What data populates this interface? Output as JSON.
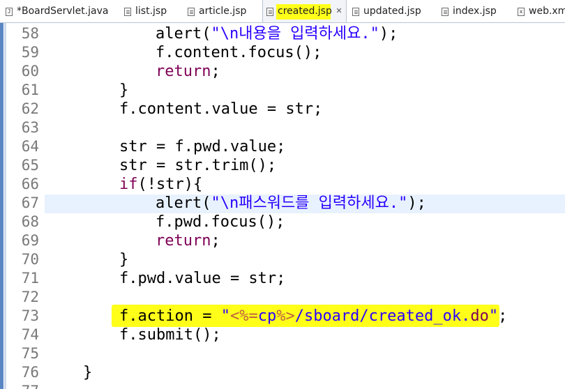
{
  "tabs": [
    {
      "label": "*BoardServlet.java",
      "icon": "java-file-icon"
    },
    {
      "label": "list.jsp",
      "icon": "jsp-file-icon"
    },
    {
      "label": "article.jsp",
      "icon": "jsp-file-icon"
    },
    {
      "label": "created.jsp",
      "icon": "jsp-file-icon",
      "active": true
    },
    {
      "label": "updated.jsp",
      "icon": "jsp-file-icon"
    },
    {
      "label": "index.jsp",
      "icon": "jsp-file-icon"
    },
    {
      "label": "web.xm",
      "icon": "xml-file-icon"
    }
  ],
  "tab_close_glyph": "✕",
  "java_icon_letter": "J",
  "xml_icon_letter": "x",
  "colors": {
    "keyword": "#7f0055",
    "string": "#2a00ff",
    "jsp_tag": "#bf5f3f",
    "highlight": "#ffff1a",
    "current_line": "#e8f2fe",
    "line_number": "#787878"
  },
  "lines": [
    {
      "n": "58",
      "parts": [
        {
          "t": "alert(",
          "c": ""
        },
        {
          "t": "\"\\n내용을 입력하세요.\"",
          "c": "str"
        },
        {
          "t": ");",
          "c": ""
        }
      ]
    },
    {
      "n": "59",
      "parts": [
        {
          "t": "f.content.focus();",
          "c": ""
        }
      ]
    },
    {
      "n": "60",
      "parts": [
        {
          "t": "return",
          "c": "kw"
        },
        {
          "t": ";",
          "c": ""
        }
      ]
    },
    {
      "n": "61",
      "parts": [
        {
          "t": "}",
          "c": ""
        }
      ]
    },
    {
      "n": "62",
      "parts": [
        {
          "t": "f.content.value = str;",
          "c": ""
        }
      ]
    },
    {
      "n": "63",
      "parts": []
    },
    {
      "n": "64",
      "parts": [
        {
          "t": "str = f.pwd.value;",
          "c": ""
        }
      ]
    },
    {
      "n": "65",
      "parts": [
        {
          "t": "str = str.trim();",
          "c": ""
        }
      ]
    },
    {
      "n": "66",
      "parts": [
        {
          "t": "if",
          "c": "kw"
        },
        {
          "t": "(!str){",
          "c": ""
        }
      ]
    },
    {
      "n": "67",
      "parts": [
        {
          "t": "alert(",
          "c": ""
        },
        {
          "t": "\"\\n패스워드를 입력하세요.\"",
          "c": "str"
        },
        {
          "t": ");",
          "c": ""
        }
      ]
    },
    {
      "n": "68",
      "parts": [
        {
          "t": "f.pwd.focus();",
          "c": ""
        }
      ]
    },
    {
      "n": "69",
      "parts": [
        {
          "t": "return",
          "c": "kw"
        },
        {
          "t": ";",
          "c": ""
        }
      ]
    },
    {
      "n": "70",
      "parts": [
        {
          "t": "}",
          "c": ""
        }
      ]
    },
    {
      "n": "71",
      "parts": [
        {
          "t": "f.pwd.value = str;",
          "c": ""
        }
      ]
    },
    {
      "n": "72",
      "parts": []
    },
    {
      "n": "73",
      "parts": [
        {
          "t": "f.action = ",
          "c": ""
        },
        {
          "t": "\"",
          "c": "str"
        },
        {
          "t": "<%=",
          "c": "tag"
        },
        {
          "t": "cp",
          "c": "str"
        },
        {
          "t": "%>",
          "c": "tag"
        },
        {
          "t": "/sboard/created_ok.",
          "c": "str"
        },
        {
          "t": "do",
          "c": "kw"
        },
        {
          "t": "\"",
          "c": "str"
        },
        {
          "t": ";",
          "c": ""
        }
      ]
    },
    {
      "n": "74",
      "parts": [
        {
          "t": "f.submit();",
          "c": ""
        }
      ]
    },
    {
      "n": "75",
      "parts": []
    },
    {
      "n": "76",
      "parts": [
        {
          "t": "}",
          "c": ""
        }
      ]
    },
    {
      "n": "77",
      "parts": []
    }
  ]
}
